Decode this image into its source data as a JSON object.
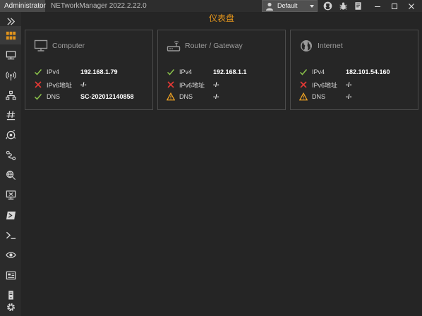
{
  "titlebar": {
    "admin_label": "Administrator",
    "app_title": "NETworkManager 2022.2.22.0",
    "profile_label": "Default"
  },
  "page": {
    "heading": "仪表盘"
  },
  "colors": {
    "accent": "#e3951c",
    "ok": "#8bc34a",
    "error": "#e53935",
    "warning": "#f5a623"
  },
  "sidebar": {
    "items": [
      {
        "icon": "expand-chevrons-icon"
      },
      {
        "icon": "dashboard-icon",
        "active": true
      },
      {
        "icon": "network-interface-icon"
      },
      {
        "icon": "wifi-icon"
      },
      {
        "icon": "ip-scanner-icon"
      },
      {
        "icon": "subnet-hash-icon"
      },
      {
        "icon": "port-scanner-icon"
      },
      {
        "icon": "traceroute-icon"
      },
      {
        "icon": "dns-lookup-icon"
      },
      {
        "icon": "remote-desktop-icon"
      },
      {
        "icon": "powershell-icon"
      },
      {
        "icon": "terminal-icon"
      },
      {
        "icon": "eye-icon"
      },
      {
        "icon": "tigervnc-icon"
      },
      {
        "icon": "server-icon"
      },
      {
        "icon": "settings-gear-icon"
      }
    ]
  },
  "cards": [
    {
      "title": "Computer",
      "icon": "monitor-icon",
      "rows": [
        {
          "status": "ok",
          "key": "IPv4",
          "value": "192.168.1.79"
        },
        {
          "status": "error",
          "key": "IPv6地址",
          "value": "-/-"
        },
        {
          "status": "ok",
          "key": "DNS",
          "value": "SC-202012140858"
        }
      ]
    },
    {
      "title": "Router / Gateway",
      "icon": "router-icon",
      "rows": [
        {
          "status": "ok",
          "key": "IPv4",
          "value": "192.168.1.1"
        },
        {
          "status": "error",
          "key": "IPv6地址",
          "value": "-/-"
        },
        {
          "status": "warning",
          "key": "DNS",
          "value": "-/-"
        }
      ]
    },
    {
      "title": "Internet",
      "icon": "globe-icon",
      "rows": [
        {
          "status": "ok",
          "key": "IPv4",
          "value": "182.101.54.160"
        },
        {
          "status": "error",
          "key": "IPv6地址",
          "value": "-/-"
        },
        {
          "status": "warning",
          "key": "DNS",
          "value": "-/-"
        }
      ]
    }
  ]
}
